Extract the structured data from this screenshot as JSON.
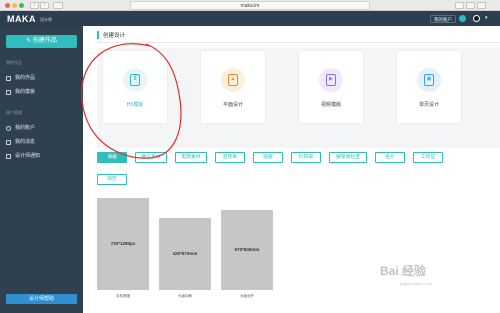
{
  "browser": {
    "url": "maka.im",
    "nav_back": "‹",
    "nav_forward": "›",
    "traffic_colors": [
      "#fc605b",
      "#fdbc40",
      "#34c84a"
    ]
  },
  "header": {
    "logo": "MAKA",
    "logo_sub": "设计师",
    "account_button": "我的账户",
    "accent": "#2c3e50"
  },
  "sidebar": {
    "create_button": "创建作品",
    "section_works": "我的作品",
    "items_works": [
      {
        "label": "我的作品",
        "icon": "grid-icon"
      },
      {
        "label": "我的模板",
        "icon": "template-icon"
      }
    ],
    "section_account": "账户管理",
    "items_account": [
      {
        "label": "我的账户",
        "icon": "user-icon"
      },
      {
        "label": "我的消息",
        "icon": "message-icon"
      },
      {
        "label": "设计师通知",
        "icon": "bell-icon"
      }
    ],
    "bottom_button": "设计师帮助"
  },
  "main": {
    "breadcrumb": "创建设计",
    "cards": [
      {
        "label": "H5模版",
        "icon": "h5-icon",
        "glyph": "5",
        "color": "#2fbdbd",
        "bubble": "#e6f7f7"
      },
      {
        "label": "平面设计",
        "icon": "image-icon",
        "glyph": "▲",
        "color": "#f08a2a",
        "bubble": "#fdeede"
      },
      {
        "label": "视频模版",
        "icon": "video-icon",
        "glyph": "▶",
        "color": "#8a6fd6",
        "bubble": "#efeaf9"
      },
      {
        "label": "单页设计",
        "icon": "page-icon",
        "glyph": "▣",
        "color": "#3aa0e8",
        "bubble": "#e3f1fc"
      }
    ],
    "tabs": [
      "海报",
      "微信素材",
      "电商素材",
      "宣传单",
      "画册",
      "价目表",
      "展架易拉宝",
      "名片",
      "工作证",
      "简历"
    ],
    "sizes": [
      {
        "size": "720*1280px",
        "label": "手机海报"
      },
      {
        "size": "420*570mm",
        "label": "大版印刷"
      },
      {
        "size": "570*840mm",
        "label": "大版对开"
      }
    ],
    "accent": "#2fbdbd"
  },
  "watermark": {
    "text": "Bai 经验",
    "sub": "jingyan.baidu.com"
  }
}
